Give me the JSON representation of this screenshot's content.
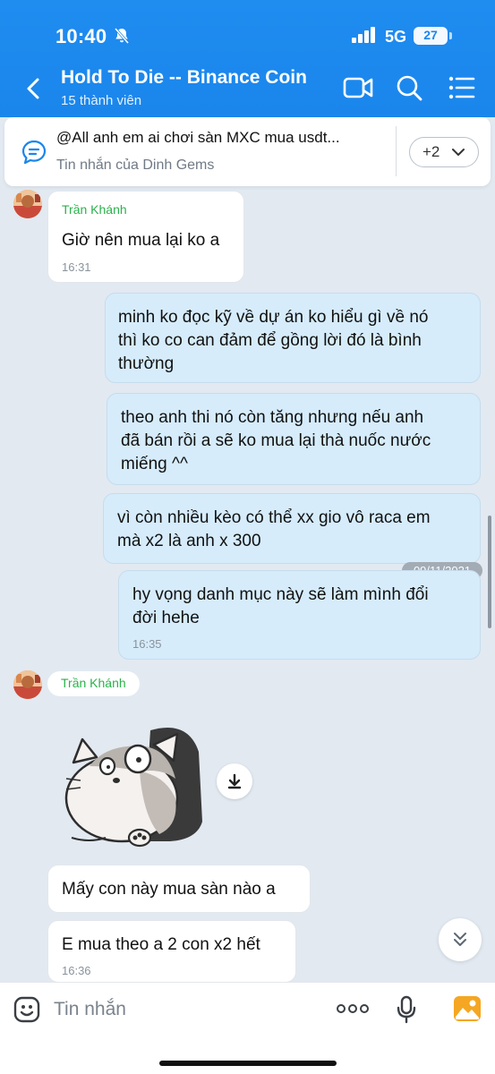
{
  "status_bar": {
    "time": "10:40",
    "network": "5G",
    "battery": "27"
  },
  "header": {
    "title": "Hold To Die -- Binance Coin",
    "subtitle": "15 thành viên",
    "back_icon": "back-chevron-icon",
    "video_icon": "video-call-icon",
    "search_icon": "search-icon",
    "menu_icon": "list-menu-icon"
  },
  "pinned": {
    "text": "@All  anh em ai chơi sàn MXC mua usdt...",
    "from": "Tin nhắn của Dinh Gems",
    "more_label": "+2"
  },
  "messages": {
    "m1": {
      "sender": "Trần Khánh",
      "text": "Giờ nên mua lại ko a",
      "time": "16:31"
    },
    "m2": {
      "lines": [
        "minh ko đọc kỹ về dự án ko hiểu gì về nó",
        "thì ko co can đảm để gồng lời đó là bình",
        "thường"
      ]
    },
    "m3": {
      "lines": [
        "theo anh thi nó còn tăng nhưng nếu anh",
        "đã bán rồi a sẽ ko mua lại thà nuốc nước",
        "miếng ^^"
      ]
    },
    "m4": {
      "lines": [
        "vì còn nhiều kèo có thể xx gio vô raca em",
        "mà x2 là anh x 300"
      ]
    },
    "date_divider": "09/11/2021",
    "m5": {
      "lines": [
        "hy vọng danh mục này sẽ làm mình đổi",
        "đời hehe"
      ],
      "time": "16:35"
    },
    "m6": {
      "sender": "Trần Khánh"
    },
    "m7": {
      "text": "Mấy con này mua sàn nào a"
    },
    "m8": {
      "text": "E mua theo a 2 con x2 hết",
      "time": "16:36"
    }
  },
  "input": {
    "placeholder": "Tin nhắn"
  },
  "colors": {
    "header_blue": "#1a86ec",
    "sender_green": "#2bb24c",
    "out_bubble": "#d6ecfb",
    "background": "#e2e9f1"
  }
}
